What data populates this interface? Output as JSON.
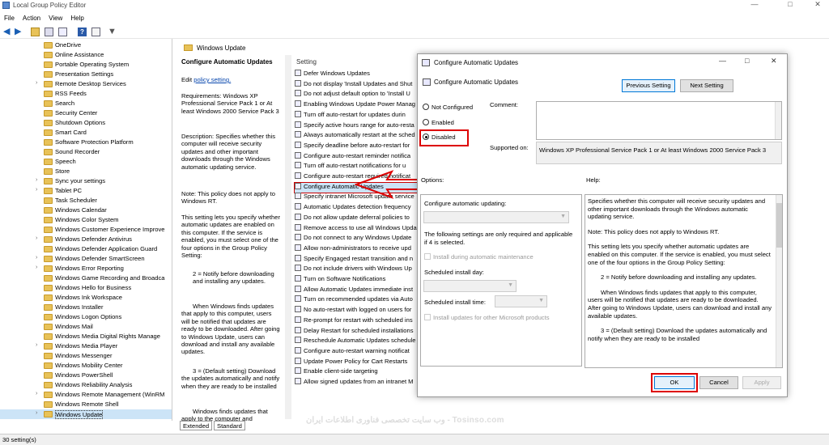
{
  "window": {
    "title": "Local Group Policy Editor"
  },
  "menu": [
    "File",
    "Action",
    "View",
    "Help"
  ],
  "tree": {
    "items": [
      {
        "label": "OneDrive",
        "arrow": ""
      },
      {
        "label": "Online Assistance",
        "arrow": ""
      },
      {
        "label": "Portable Operating System",
        "arrow": ""
      },
      {
        "label": "Presentation Settings",
        "arrow": ""
      },
      {
        "label": "Remote Desktop Services",
        "arrow": "›"
      },
      {
        "label": "RSS Feeds",
        "arrow": ""
      },
      {
        "label": "Search",
        "arrow": ""
      },
      {
        "label": "Security Center",
        "arrow": ""
      },
      {
        "label": "Shutdown Options",
        "arrow": ""
      },
      {
        "label": "Smart Card",
        "arrow": ""
      },
      {
        "label": "Software Protection Platform",
        "arrow": ""
      },
      {
        "label": "Sound Recorder",
        "arrow": ""
      },
      {
        "label": "Speech",
        "arrow": ""
      },
      {
        "label": "Store",
        "arrow": ""
      },
      {
        "label": "Sync your settings",
        "arrow": "›"
      },
      {
        "label": "Tablet PC",
        "arrow": "›"
      },
      {
        "label": "Task Scheduler",
        "arrow": ""
      },
      {
        "label": "Windows Calendar",
        "arrow": ""
      },
      {
        "label": "Windows Color System",
        "arrow": ""
      },
      {
        "label": "Windows Customer Experience Improve",
        "arrow": ""
      },
      {
        "label": "Windows Defender Antivirus",
        "arrow": "›"
      },
      {
        "label": "Windows Defender Application Guard",
        "arrow": ""
      },
      {
        "label": "Windows Defender SmartScreen",
        "arrow": "›"
      },
      {
        "label": "Windows Error Reporting",
        "arrow": "›"
      },
      {
        "label": "Windows Game Recording and Broadca",
        "arrow": ""
      },
      {
        "label": "Windows Hello for Business",
        "arrow": ""
      },
      {
        "label": "Windows Ink Workspace",
        "arrow": ""
      },
      {
        "label": "Windows Installer",
        "arrow": ""
      },
      {
        "label": "Windows Logon Options",
        "arrow": ""
      },
      {
        "label": "Windows Mail",
        "arrow": ""
      },
      {
        "label": "Windows Media Digital Rights Manage",
        "arrow": ""
      },
      {
        "label": "Windows Media Player",
        "arrow": "›"
      },
      {
        "label": "Windows Messenger",
        "arrow": ""
      },
      {
        "label": "Windows Mobility Center",
        "arrow": ""
      },
      {
        "label": "Windows PowerShell",
        "arrow": ""
      },
      {
        "label": "Windows Reliability Analysis",
        "arrow": ""
      },
      {
        "label": "Windows Remote Management (WinRM",
        "arrow": "›"
      },
      {
        "label": "Windows Remote Shell",
        "arrow": ""
      },
      {
        "label": "Windows Update",
        "arrow": "›"
      }
    ],
    "selected_index": 38
  },
  "header": {
    "title": "Windows Update"
  },
  "description": {
    "title": "Configure Automatic Updates",
    "edit_prefix": "Edit",
    "edit_link": "policy setting.",
    "requirements": "Requirements: Windows XP Professional Service Pack 1 or At least Windows 2000 Service Pack 3",
    "description": "Description: Specifies whether this computer will receive security updates and other important downloads through the Windows automatic updating service.",
    "note": "Note: This policy does not apply to Windows RT.",
    "p1": "This setting lets you specify whether automatic updates are enabled on this computer. If the service is enabled, you must select one of the four options in the Group Policy Setting:",
    "p2": "2 = Notify before downloading and installing any updates.",
    "p3": "When Windows finds updates that apply to this computer, users will be notified that updates are ready to be downloaded. After going to Windows Update, users can download and install any available updates.",
    "p4": "3 = (Default setting) Download the updates automatically and notify when they are ready to be installed",
    "p5": "Windows finds updates that apply to the computer and"
  },
  "tabs": [
    "Extended",
    "Standard"
  ],
  "settings": {
    "header": "Setting",
    "items": [
      "Defer Windows Updates",
      "Do not display 'Install Updates and Shut",
      "Do not adjust default option to 'Install U",
      "Enabling Windows Update Power Manag",
      "Turn off auto-restart for updates durin",
      "Specify active hours range for auto-resta",
      "Always automatically restart at the sched",
      "Specify deadline before auto-restart for",
      "Configure auto-restart reminder notifica",
      "Turn off auto-restart notifications for u",
      "Configure auto-restart required notificat",
      "Configure Automatic Updates",
      "Specify intranet Microsoft update service",
      "Automatic Updates detection frequency",
      "Do not allow update deferral policies to",
      "Remove access to use all Windows Upda",
      "Do not connect to any Windows Update",
      "Allow non-administrators to receive upd",
      "Specify Engaged restart transition and n",
      "Do not include drivers with Windows Up",
      "Turn on Software Notifications",
      "Allow Automatic Updates immediate inst",
      "Turn on recommended updates via Auto",
      "No auto-restart with logged on users for",
      "Re-prompt for restart with scheduled ins",
      "Delay Restart for scheduled installations",
      "Reschedule Automatic Updates schedule",
      "Configure auto-restart warning notificat",
      "Update Power Policy for Cart Restarts",
      "Enable client-side targeting",
      "Allow signed updates from an intranet M"
    ],
    "selected_index": 11
  },
  "dialog": {
    "title": "Configure Automatic Updates",
    "subtitle": "Configure Automatic Updates",
    "prev_button": "Previous Setting",
    "next_button": "Next Setting",
    "radio_not_configured": "Not Configured",
    "radio_enabled": "Enabled",
    "radio_disabled": "Disabled",
    "selected_radio": "Disabled",
    "comment_label": "Comment:",
    "supported_label": "Supported on:",
    "supported_value": "Windows XP Professional Service Pack 1 or At least Windows 2000 Service Pack 3",
    "options_label": "Options:",
    "help_label": "Help:",
    "configure_updating_label": "Configure automatic updating:",
    "options_note": "The following settings are only required and applicable if 4 is selected.",
    "install_maintenance": "Install during automatic maintenance",
    "scheduled_day_label": "Scheduled install day:",
    "scheduled_time_label": "Scheduled install time:",
    "install_other": "Install updates for other Microsoft products",
    "help_p1": "Specifies whether this computer will receive security updates and other important downloads through the Windows automatic updating service.",
    "help_p2": "Note: This policy does not apply to Windows RT.",
    "help_p3": "This setting lets you specify whether automatic updates are enabled on this computer. If the service is enabled, you must select one of the four options in the Group Policy Setting:",
    "help_p4": "2 = Notify before downloading and installing any updates.",
    "help_p5": "When Windows finds updates that apply to this computer, users will be notified that updates are ready to be downloaded. After going to Windows Update, users can download and install any available updates.",
    "help_p6": "3 = (Default setting) Download the updates automatically and notify when they are ready to be installed",
    "ok_button": "OK",
    "cancel_button": "Cancel",
    "apply_button": "Apply"
  },
  "status": {
    "text": "30 setting(s)"
  },
  "watermark": "وب سایت تخصصی فناوری اطلاعات ایران - Tosinso.com",
  "colors": {
    "highlight": "#cce4f7",
    "annotation_red": "#d00000",
    "folder": "#e8c258"
  }
}
